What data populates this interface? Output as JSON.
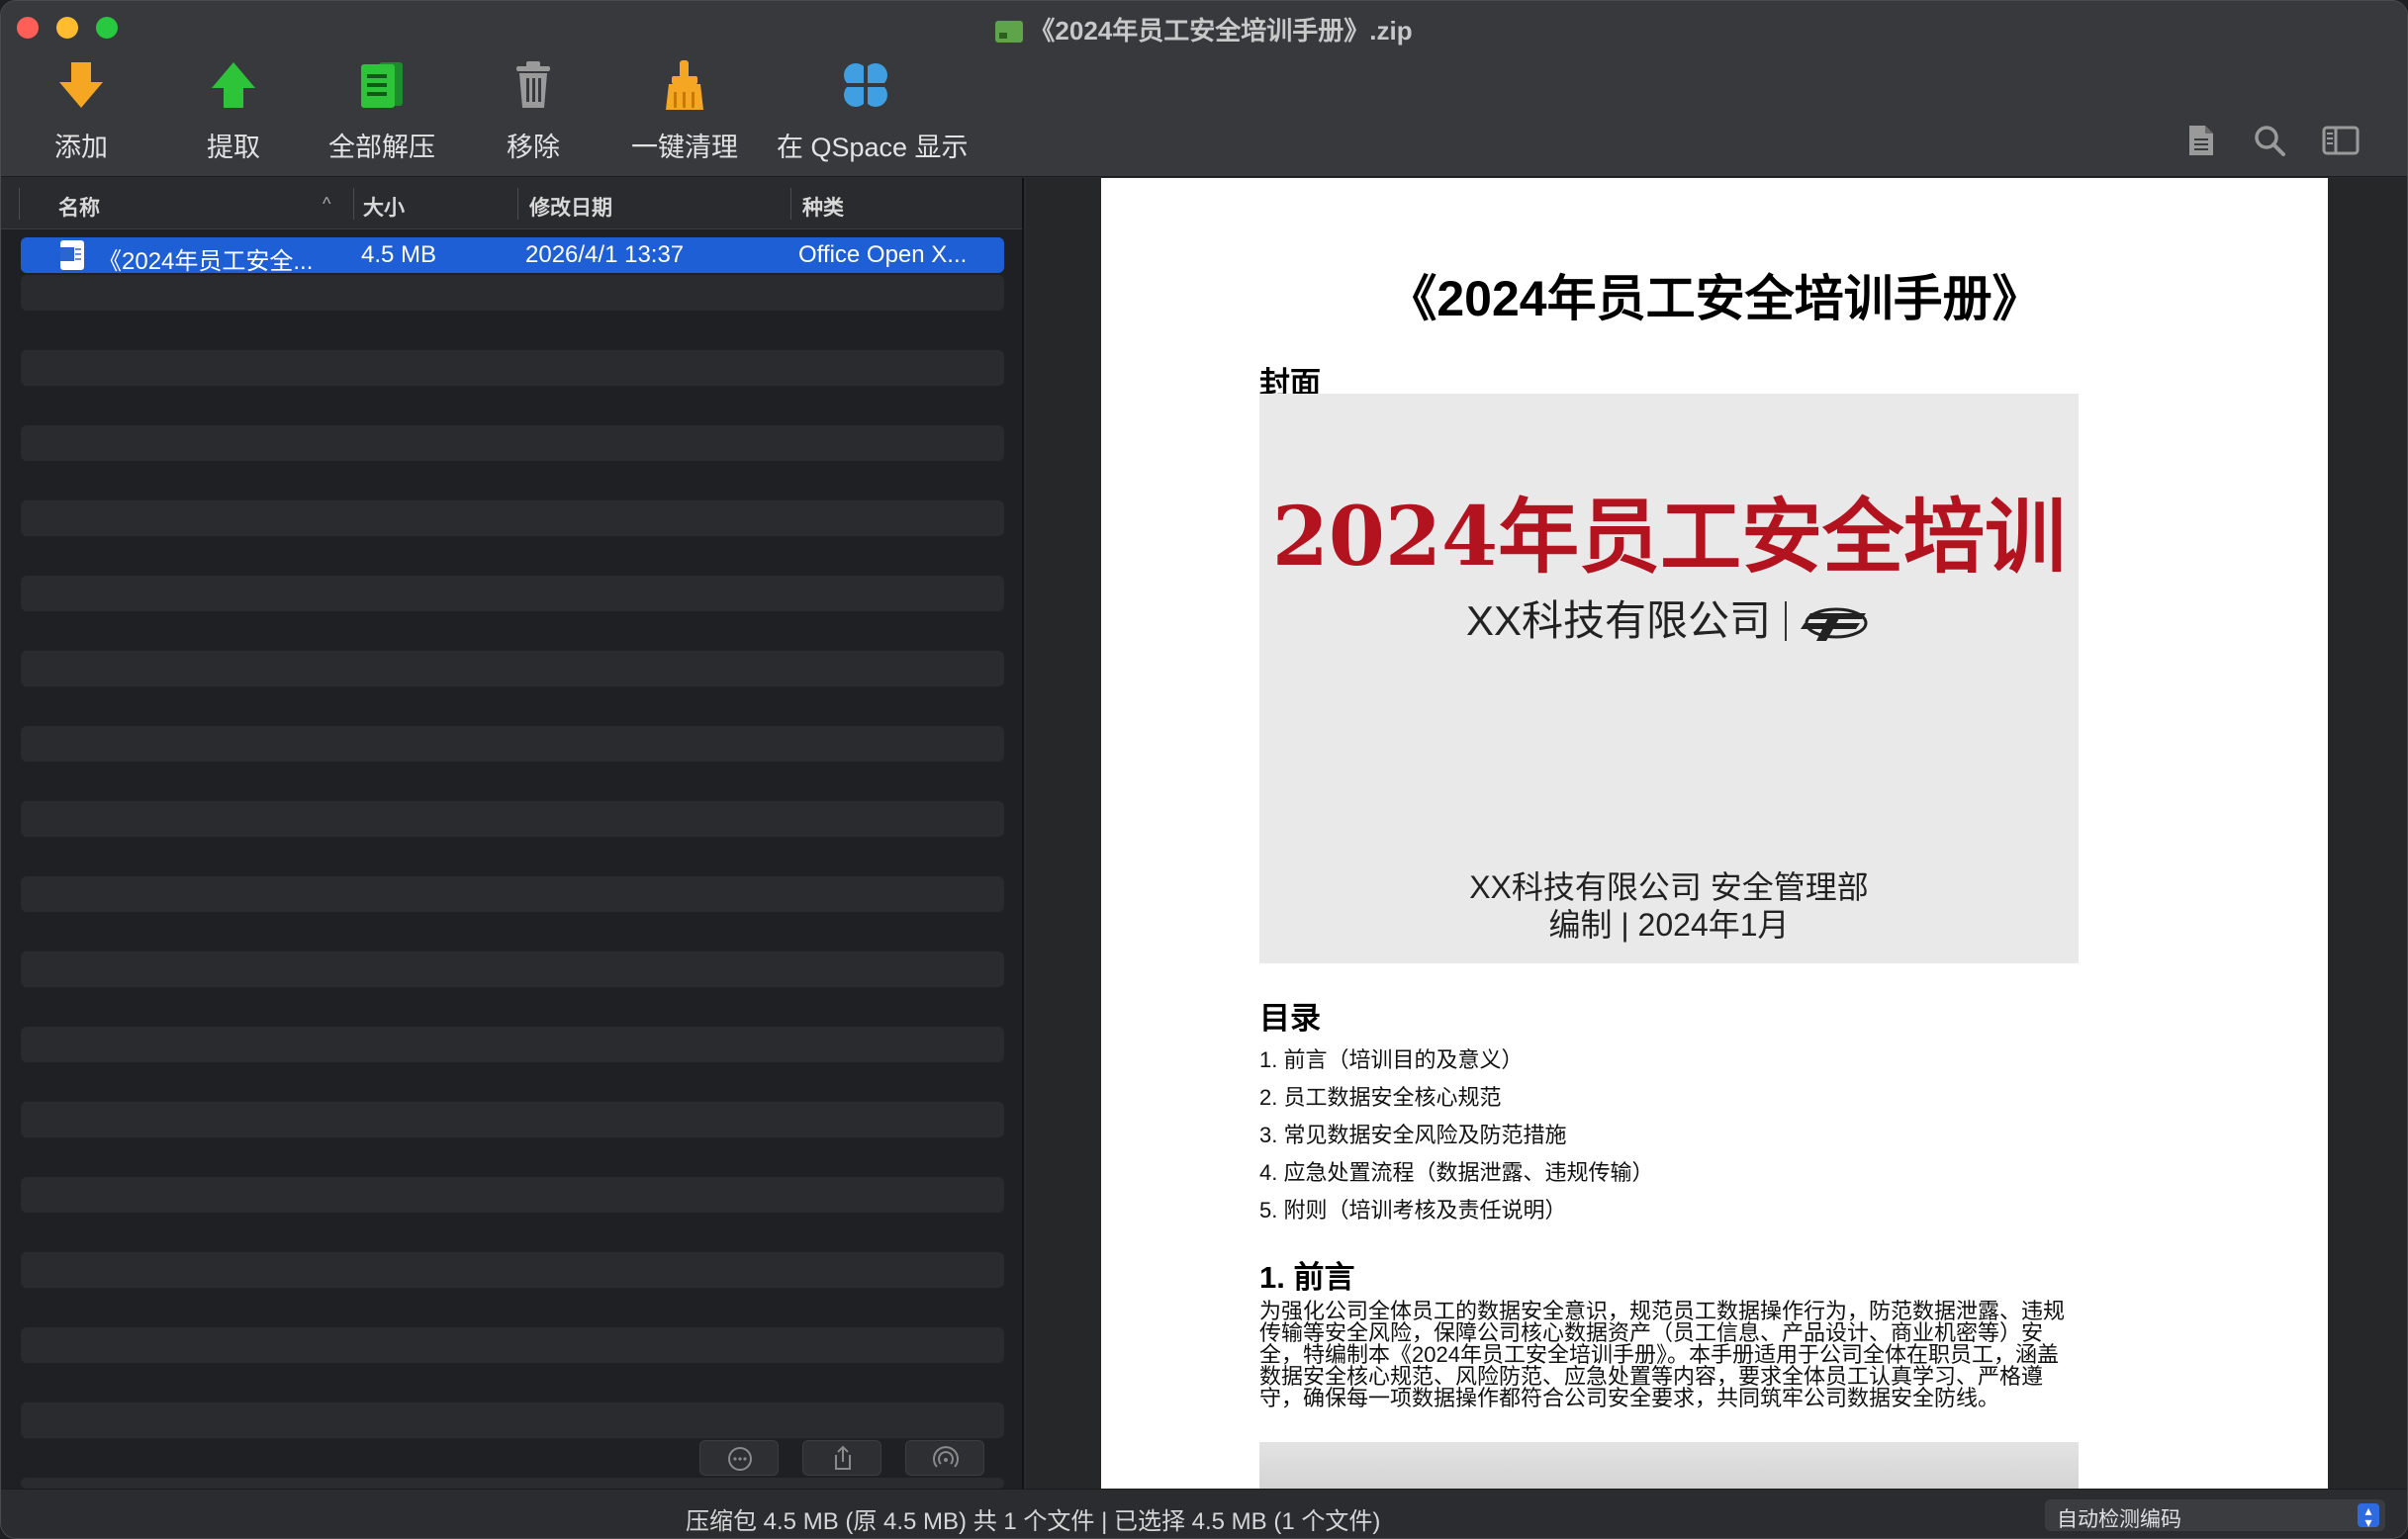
{
  "window": {
    "title": "《2024年员工安全培训手册》.zip"
  },
  "toolbar": {
    "add": "添加",
    "extract": "提取",
    "extract_all": "全部解压",
    "remove": "移除",
    "clean": "一键清理",
    "show_in_qspace": "在 QSpace 显示"
  },
  "columns": {
    "name": "名称",
    "size": "大小",
    "modified": "修改日期",
    "kind": "种类"
  },
  "files": [
    {
      "name": "《2024年员工安全...",
      "size": "4.5 MB",
      "modified": "2026/4/1 13:37",
      "kind": "Office Open X..."
    }
  ],
  "preview": {
    "doc_title": "《2024年员工安全培训手册》",
    "cover_heading": "封面",
    "cover": {
      "title": "2024年员工安全培训",
      "company": "XX科技有限公司",
      "dept": "XX科技有限公司 安全管理部",
      "date": "编制 | 2024年1月"
    },
    "toc_heading": "目录",
    "toc": [
      "1.  前言（培训目的及意义）",
      "2.  员工数据安全核心规范",
      "3.  常见数据安全风险及防范措施",
      "4.  应急处置流程（数据泄露、违规传输）",
      "5.  附则（培训考核及责任说明）"
    ],
    "section1_heading": "1.  前言",
    "section1_lines": [
      "为强化公司全体员工的数据安全意识，规范员工数据操作行为，防范数据泄露、违规",
      "传输等安全风险，保障公司核心数据资产（员工信息、产品设计、商业机密等）安",
      "全，特编制本《2024年员工安全培训手册》。本手册适用于公司全体在职员工，涵盖",
      "数据安全核心规范、风险防范、应急处置等内容，要求全体员工认真学习、严格遵",
      "守，确保每一项数据操作都符合公司安全要求，共同筑牢公司数据安全防线。"
    ]
  },
  "status": {
    "summary": "压缩包 4.5 MB (原 4.5 MB) 共 1 个文件  |  已选择 4.5 MB (1 个文件)",
    "encoding": "自动检测编码"
  },
  "colors": {
    "selection": "#1f5fd6",
    "cover_red": "#b3121f",
    "add_orange": "#f5a623",
    "extract_green": "#2ec43a"
  }
}
